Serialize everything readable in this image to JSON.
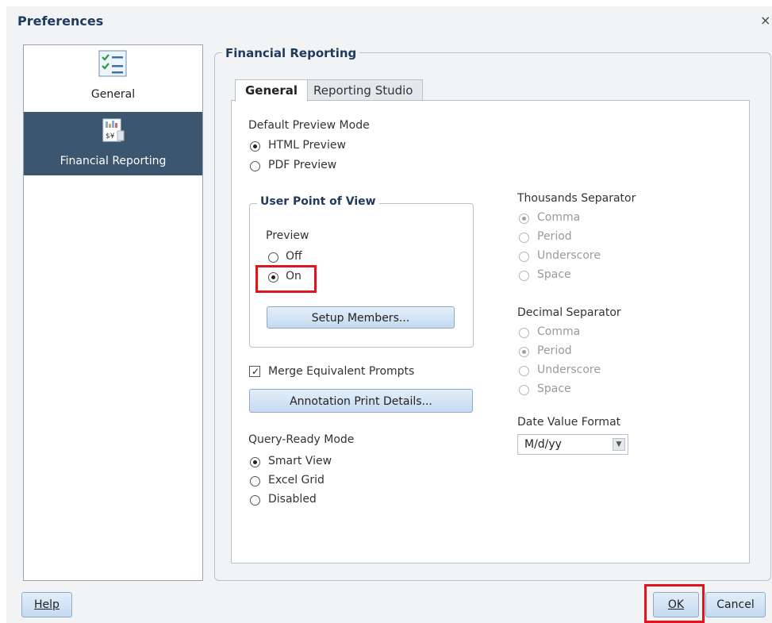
{
  "window": {
    "title": "Preferences",
    "close_symbol": "×"
  },
  "sidebar": {
    "items": [
      {
        "label": "General",
        "icon": "checklist-icon",
        "selected": false
      },
      {
        "label": "Financial Reporting",
        "icon": "financial-report-icon",
        "selected": true
      }
    ]
  },
  "main": {
    "group_title": "Financial Reporting",
    "tabs": [
      {
        "label": "General",
        "active": true
      },
      {
        "label": "Reporting Studio",
        "active": false
      }
    ],
    "default_preview": {
      "title": "Default Preview Mode",
      "options": [
        "HTML Preview",
        "PDF Preview"
      ],
      "selected": "HTML Preview"
    },
    "user_pov": {
      "title": "User Point of View",
      "preview_label": "Preview",
      "options": [
        "Off",
        "On"
      ],
      "selected": "On",
      "setup_button": "Setup Members..."
    },
    "merge_prompts": {
      "label": "Merge Equivalent Prompts",
      "checked": true
    },
    "annotation_button": "Annotation Print Details...",
    "query_ready": {
      "title": "Query-Ready Mode",
      "options": [
        "Smart View",
        "Excel Grid",
        "Disabled"
      ],
      "selected": "Smart View"
    },
    "thousands_separator": {
      "title": "Thousands Separator",
      "options": [
        "Comma",
        "Period",
        "Underscore",
        "Space"
      ],
      "selected": "Comma"
    },
    "decimal_separator": {
      "title": "Decimal Separator",
      "options": [
        "Comma",
        "Period",
        "Underscore",
        "Space"
      ],
      "selected": "Period"
    },
    "date_format": {
      "title": "Date Value Format",
      "value": "M/d/yy"
    }
  },
  "footer": {
    "help": "Help",
    "ok": "OK",
    "cancel": "Cancel"
  },
  "colors": {
    "highlight": "#e0141e",
    "sidebar_selected": "#3d5670",
    "title": "#1f3a5c"
  }
}
